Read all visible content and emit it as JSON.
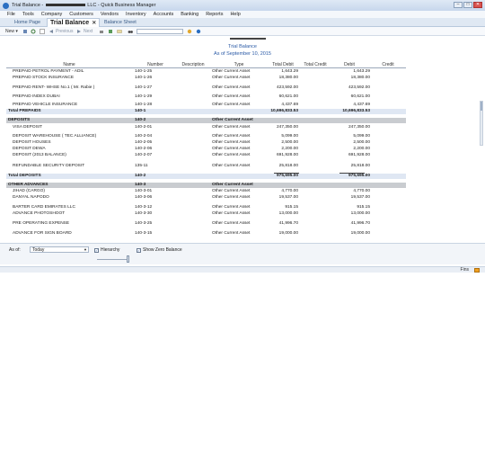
{
  "window": {
    "title_prefix": "Trial Balance - ",
    "title_suffix": " LLC - Quick Business Manager",
    "controls": [
      "–",
      "□",
      "✕"
    ]
  },
  "menu": [
    "File",
    "Tools",
    "Company",
    "Customers",
    "Vendors",
    "Inventory",
    "Accounts",
    "Banking",
    "Reports",
    "Help"
  ],
  "tabs": {
    "home": "Home Page",
    "active": "Trial Balance",
    "balance": "Balance Sheet",
    "close": "✕"
  },
  "toolbar": {
    "new": "New ▾",
    "previous": "Previous",
    "next": "Next"
  },
  "report": {
    "title": "Trial Balance",
    "subtitle": "As of September 10, 2015",
    "columns": {
      "name": "Name",
      "number": "Number",
      "description": "Description",
      "type": "Type",
      "total_debit": "Total Debit",
      "total_credit": "Total Credit",
      "debit": "Debit",
      "credit": "Credit"
    },
    "rows": [
      {
        "name": "PREPAID PETROL PAYMENT - ADIL",
        "number": "140-1-25",
        "type": "Other Current Asset",
        "total_debit": "1,643.29",
        "debit": "1,643.29"
      },
      {
        "name": "PREPAID STOCK INSURANCE",
        "number": "140-1-26",
        "type": "Other Current Asset",
        "total_debit": "18,380.00",
        "debit": "18,380.00"
      },
      {
        "name": "PREPAID RENT- WHSE No.1 ( Mr. Rabie )",
        "number": "140-1-27",
        "type": "Other Current Asset",
        "total_debit": "423,592.00",
        "debit": "423,592.00"
      },
      {
        "name": "PREPAID INDEX DUBAI",
        "number": "140-1-29",
        "type": "Other Current Asset",
        "total_debit": "60,621.00",
        "debit": "60,621.00"
      },
      {
        "name": "PREPAID VEHICLE INSURANCE",
        "number": "140-1-28",
        "type": "Other Current Asset",
        "total_debit": "4,437.69",
        "debit": "4,437.69"
      },
      {
        "name": "Total PREPAIDS",
        "number": "140-1",
        "type": "",
        "total_debit": "10,696,833.53",
        "debit": "10,696,833.53"
      },
      {
        "name": "DEPOSITS",
        "number": "140-2",
        "type": "Other Current Asset",
        "total_debit": "",
        "debit": ""
      },
      {
        "name": "VISA DEPOSIT",
        "number": "140-2-01",
        "type": "Other Current Asset",
        "total_debit": "247,350.00",
        "debit": "247,350.00"
      },
      {
        "name": "DEPOSIT WAREHOUSE ( TEC ALLIANCE)",
        "number": "140-2-04",
        "type": "Other Current Asset",
        "total_debit": "5,099.00",
        "debit": "5,099.00"
      },
      {
        "name": "DEPOSIT HOUSES",
        "number": "140-2-05",
        "type": "Other Current Asset",
        "total_debit": "2,500.00",
        "debit": "2,500.00"
      },
      {
        "name": "DEPOSIT DEWA",
        "number": "140-2-06",
        "type": "Other Current Asset",
        "total_debit": "2,200.00",
        "debit": "2,200.00"
      },
      {
        "name": "DEPOSIT (2013 BALANCE)",
        "number": "140-2-07",
        "type": "Other Current Asset",
        "total_debit": "691,928.00",
        "debit": "691,928.00"
      },
      {
        "name": "REFUNDABLE SECURITY DEPOSIT",
        "number": "135-11",
        "type": "Other Current Asset",
        "total_debit": "25,818.00",
        "debit": "25,818.00"
      },
      {
        "name": "Total DEPOSITS",
        "number": "140-2",
        "type": "",
        "total_debit": "975,695.00",
        "debit": "975,695.00"
      },
      {
        "name": "OTHER ADVANCES",
        "number": "140-3",
        "type": "Other Current Asset",
        "total_debit": "",
        "debit": ""
      },
      {
        "name": "JIHAD (CARGO)",
        "number": "140-3-01",
        "type": "Other Current Asset",
        "total_debit": "4,770.00",
        "debit": "4,770.00"
      },
      {
        "name": "DANYAL NAPODO",
        "number": "140-3-06",
        "type": "Other Current Asset",
        "total_debit": "19,537.00",
        "debit": "19,537.00"
      },
      {
        "name": "BARTER CARD EMIRATES LLC",
        "number": "140-3-12",
        "type": "Other Current Asset",
        "total_debit": "915.15",
        "debit": "915.15"
      },
      {
        "name": "ADVANCE PHOTOSHOOT",
        "number": "140-3-30",
        "type": "Other Current Asset",
        "total_debit": "13,000.00",
        "debit": "13,000.00"
      },
      {
        "name": "PRE OPERATING EXPENSE",
        "number": "140-3-25",
        "type": "Other Current Asset",
        "total_debit": "41,996.70",
        "debit": "41,996.70"
      },
      {
        "name": "ADVANCE FOR SIGN BOARD",
        "number": "140-3-15",
        "type": "Other Current Asset",
        "total_debit": "19,000.00",
        "debit": "19,000.00"
      }
    ]
  },
  "filters": {
    "as_of_label": "As of:",
    "as_of_value": "Today",
    "hierarchy_label": "Hierarchy",
    "show_zero_label": "Show Zero Balance",
    "check": "✓"
  },
  "status": {
    "text": "Fins"
  }
}
